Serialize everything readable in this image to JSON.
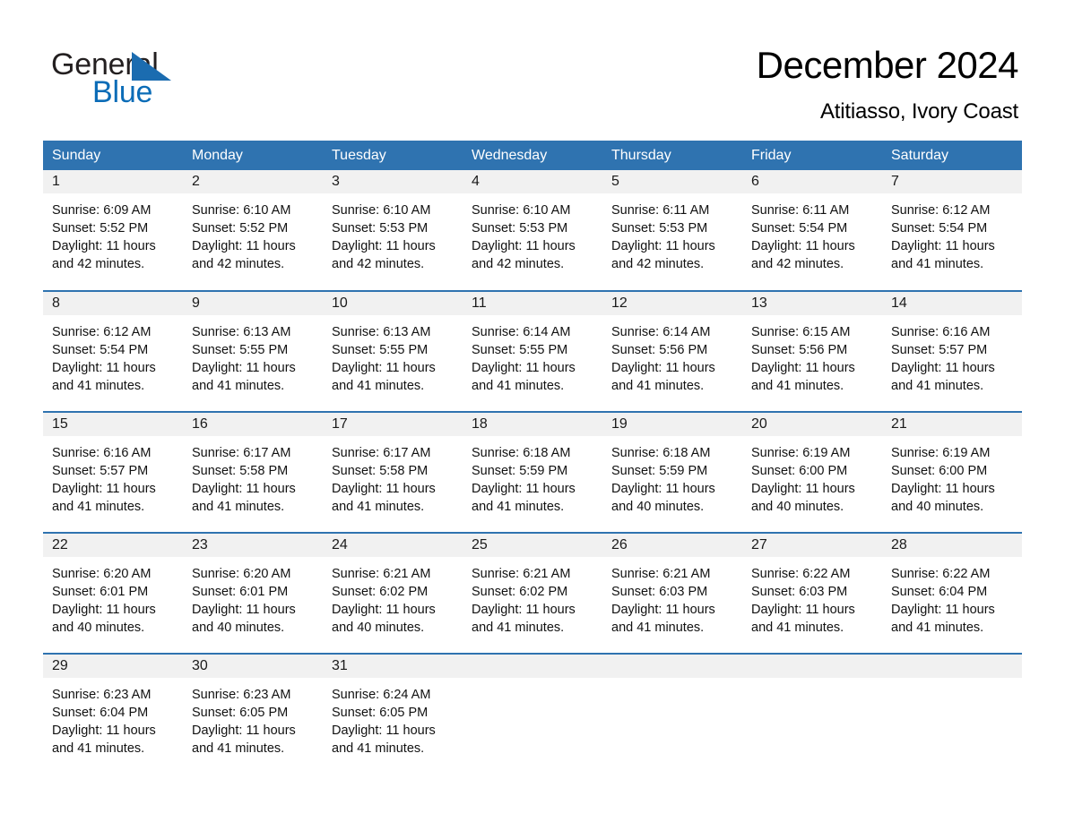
{
  "brand": {
    "name_part1": "General",
    "name_part2": "Blue",
    "triangle_color": "#1b6cb0",
    "blue_text_color": "#0b6cb7"
  },
  "header": {
    "title": "December 2024",
    "subtitle": "Atitiasso, Ivory Coast"
  },
  "theme": {
    "header_blue": "#2f73b0",
    "daynum_band": "#f1f1f1",
    "row_rule": "#2f73b0"
  },
  "weekdays": [
    "Sunday",
    "Monday",
    "Tuesday",
    "Wednesday",
    "Thursday",
    "Friday",
    "Saturday"
  ],
  "weeks": [
    [
      {
        "day": "1",
        "sunrise": "Sunrise: 6:09 AM",
        "sunset": "Sunset: 5:52 PM",
        "daylight": "Daylight: 11 hours and 42 minutes."
      },
      {
        "day": "2",
        "sunrise": "Sunrise: 6:10 AM",
        "sunset": "Sunset: 5:52 PM",
        "daylight": "Daylight: 11 hours and 42 minutes."
      },
      {
        "day": "3",
        "sunrise": "Sunrise: 6:10 AM",
        "sunset": "Sunset: 5:53 PM",
        "daylight": "Daylight: 11 hours and 42 minutes."
      },
      {
        "day": "4",
        "sunrise": "Sunrise: 6:10 AM",
        "sunset": "Sunset: 5:53 PM",
        "daylight": "Daylight: 11 hours and 42 minutes."
      },
      {
        "day": "5",
        "sunrise": "Sunrise: 6:11 AM",
        "sunset": "Sunset: 5:53 PM",
        "daylight": "Daylight: 11 hours and 42 minutes."
      },
      {
        "day": "6",
        "sunrise": "Sunrise: 6:11 AM",
        "sunset": "Sunset: 5:54 PM",
        "daylight": "Daylight: 11 hours and 42 minutes."
      },
      {
        "day": "7",
        "sunrise": "Sunrise: 6:12 AM",
        "sunset": "Sunset: 5:54 PM",
        "daylight": "Daylight: 11 hours and 41 minutes."
      }
    ],
    [
      {
        "day": "8",
        "sunrise": "Sunrise: 6:12 AM",
        "sunset": "Sunset: 5:54 PM",
        "daylight": "Daylight: 11 hours and 41 minutes."
      },
      {
        "day": "9",
        "sunrise": "Sunrise: 6:13 AM",
        "sunset": "Sunset: 5:55 PM",
        "daylight": "Daylight: 11 hours and 41 minutes."
      },
      {
        "day": "10",
        "sunrise": "Sunrise: 6:13 AM",
        "sunset": "Sunset: 5:55 PM",
        "daylight": "Daylight: 11 hours and 41 minutes."
      },
      {
        "day": "11",
        "sunrise": "Sunrise: 6:14 AM",
        "sunset": "Sunset: 5:55 PM",
        "daylight": "Daylight: 11 hours and 41 minutes."
      },
      {
        "day": "12",
        "sunrise": "Sunrise: 6:14 AM",
        "sunset": "Sunset: 5:56 PM",
        "daylight": "Daylight: 11 hours and 41 minutes."
      },
      {
        "day": "13",
        "sunrise": "Sunrise: 6:15 AM",
        "sunset": "Sunset: 5:56 PM",
        "daylight": "Daylight: 11 hours and 41 minutes."
      },
      {
        "day": "14",
        "sunrise": "Sunrise: 6:16 AM",
        "sunset": "Sunset: 5:57 PM",
        "daylight": "Daylight: 11 hours and 41 minutes."
      }
    ],
    [
      {
        "day": "15",
        "sunrise": "Sunrise: 6:16 AM",
        "sunset": "Sunset: 5:57 PM",
        "daylight": "Daylight: 11 hours and 41 minutes."
      },
      {
        "day": "16",
        "sunrise": "Sunrise: 6:17 AM",
        "sunset": "Sunset: 5:58 PM",
        "daylight": "Daylight: 11 hours and 41 minutes."
      },
      {
        "day": "17",
        "sunrise": "Sunrise: 6:17 AM",
        "sunset": "Sunset: 5:58 PM",
        "daylight": "Daylight: 11 hours and 41 minutes."
      },
      {
        "day": "18",
        "sunrise": "Sunrise: 6:18 AM",
        "sunset": "Sunset: 5:59 PM",
        "daylight": "Daylight: 11 hours and 41 minutes."
      },
      {
        "day": "19",
        "sunrise": "Sunrise: 6:18 AM",
        "sunset": "Sunset: 5:59 PM",
        "daylight": "Daylight: 11 hours and 40 minutes."
      },
      {
        "day": "20",
        "sunrise": "Sunrise: 6:19 AM",
        "sunset": "Sunset: 6:00 PM",
        "daylight": "Daylight: 11 hours and 40 minutes."
      },
      {
        "day": "21",
        "sunrise": "Sunrise: 6:19 AM",
        "sunset": "Sunset: 6:00 PM",
        "daylight": "Daylight: 11 hours and 40 minutes."
      }
    ],
    [
      {
        "day": "22",
        "sunrise": "Sunrise: 6:20 AM",
        "sunset": "Sunset: 6:01 PM",
        "daylight": "Daylight: 11 hours and 40 minutes."
      },
      {
        "day": "23",
        "sunrise": "Sunrise: 6:20 AM",
        "sunset": "Sunset: 6:01 PM",
        "daylight": "Daylight: 11 hours and 40 minutes."
      },
      {
        "day": "24",
        "sunrise": "Sunrise: 6:21 AM",
        "sunset": "Sunset: 6:02 PM",
        "daylight": "Daylight: 11 hours and 40 minutes."
      },
      {
        "day": "25",
        "sunrise": "Sunrise: 6:21 AM",
        "sunset": "Sunset: 6:02 PM",
        "daylight": "Daylight: 11 hours and 41 minutes."
      },
      {
        "day": "26",
        "sunrise": "Sunrise: 6:21 AM",
        "sunset": "Sunset: 6:03 PM",
        "daylight": "Daylight: 11 hours and 41 minutes."
      },
      {
        "day": "27",
        "sunrise": "Sunrise: 6:22 AM",
        "sunset": "Sunset: 6:03 PM",
        "daylight": "Daylight: 11 hours and 41 minutes."
      },
      {
        "day": "28",
        "sunrise": "Sunrise: 6:22 AM",
        "sunset": "Sunset: 6:04 PM",
        "daylight": "Daylight: 11 hours and 41 minutes."
      }
    ],
    [
      {
        "day": "29",
        "sunrise": "Sunrise: 6:23 AM",
        "sunset": "Sunset: 6:04 PM",
        "daylight": "Daylight: 11 hours and 41 minutes."
      },
      {
        "day": "30",
        "sunrise": "Sunrise: 6:23 AM",
        "sunset": "Sunset: 6:05 PM",
        "daylight": "Daylight: 11 hours and 41 minutes."
      },
      {
        "day": "31",
        "sunrise": "Sunrise: 6:24 AM",
        "sunset": "Sunset: 6:05 PM",
        "daylight": "Daylight: 11 hours and 41 minutes."
      },
      {
        "day": "",
        "sunrise": "",
        "sunset": "",
        "daylight": ""
      },
      {
        "day": "",
        "sunrise": "",
        "sunset": "",
        "daylight": ""
      },
      {
        "day": "",
        "sunrise": "",
        "sunset": "",
        "daylight": ""
      },
      {
        "day": "",
        "sunrise": "",
        "sunset": "",
        "daylight": ""
      }
    ]
  ]
}
